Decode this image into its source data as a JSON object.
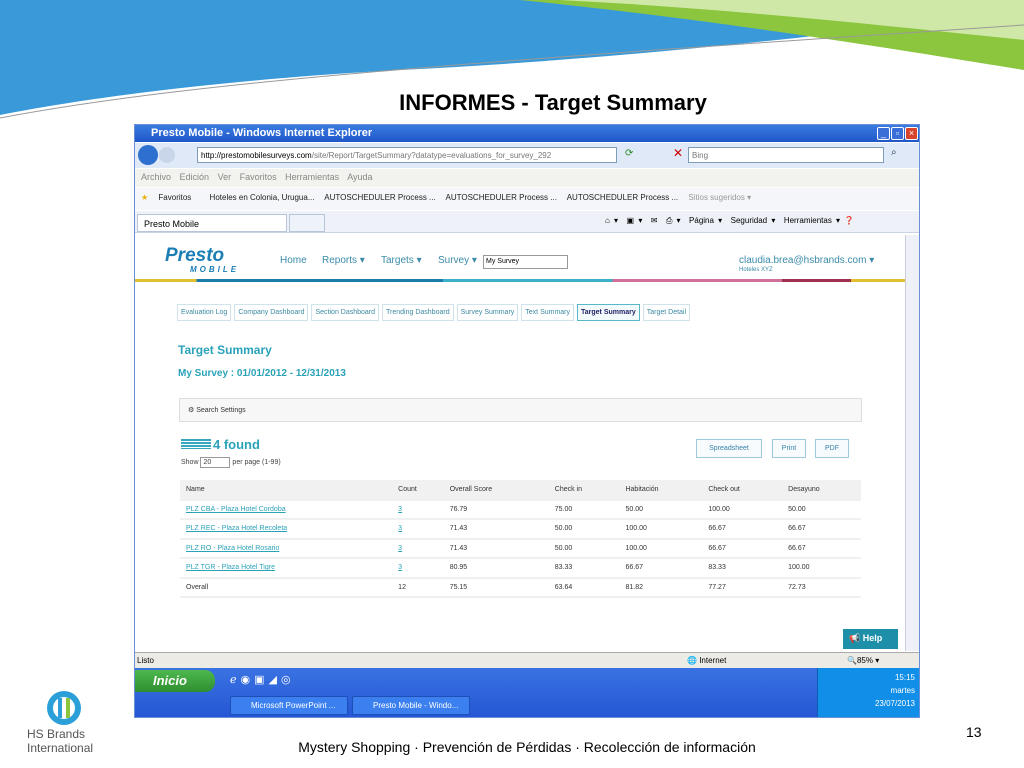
{
  "slide": {
    "title": "INFORMES - Target Summary",
    "footer": "Mystery Shopping · Prevención de Pérdidas · Recolección de información",
    "page_number": "13",
    "logo_line1": "HS Brands",
    "logo_line2": "International"
  },
  "browser": {
    "title": "Presto Mobile - Windows Internet Explorer",
    "url_host": "http://prestomobilesurveys.com",
    "url_path": "/site/Report/TargetSummary?datatype=evaluations_for_survey_292",
    "search_placeholder": "Bing",
    "menu": [
      "Archivo",
      "Edición",
      "Ver",
      "Favoritos",
      "Herramientas",
      "Ayuda"
    ],
    "favorites_label": "Favoritos",
    "favorites": [
      "Hoteles en Colonia, Urugua...",
      "AUTOSCHEDULER  Process ...",
      "AUTOSCHEDULER  Process ...",
      "AUTOSCHEDULER  Process ...",
      "Sitios sugeridos ▾"
    ],
    "tab": "Presto Mobile",
    "commands": [
      "Página ▾",
      "Seguridad ▾",
      "Herramientas ▾"
    ],
    "status": "Listo",
    "zone": "Internet",
    "zoom": "85%"
  },
  "app": {
    "logo_top": "Presto",
    "logo_bottom": "MOBILE",
    "nav": [
      "Home",
      "Reports ▾",
      "Targets ▾",
      "Survey ▾"
    ],
    "survey_value": "My Survey",
    "user_email": "claudia.brea@hsbrands.com",
    "user_company": "Hoteles XYZ",
    "tabs": [
      "Evaluation Log",
      "Company Dashboard",
      "Section Dashboard",
      "Trending Dashboard",
      "Survey Summary",
      "Text Summary",
      "Target Summary",
      "Target Detail"
    ],
    "active_tab": 6,
    "page_title": "Target Summary",
    "subtitle": "My Survey : 01/01/2012 - 12/31/2013",
    "search_settings": "Search Settings",
    "found": "4 found",
    "show_label": "Show",
    "per_page": "20",
    "per_page_suffix": "per page (1-99)",
    "buttons": [
      "Spreadsheet",
      "Print",
      "PDF"
    ],
    "help": "Help",
    "columns": [
      "Name",
      "Count",
      "Overall Score",
      "Check in",
      "Habitación",
      "Check out",
      "Desayuno"
    ],
    "rows": [
      [
        "PLZ CBA - Plaza Hotel Cordoba",
        "3",
        "76.79",
        "75.00",
        "50.00",
        "100.00",
        "50.00"
      ],
      [
        "PLZ REC - Plaza Hotel Recoleta",
        "3",
        "71.43",
        "50.00",
        "100.00",
        "66.67",
        "66.67"
      ],
      [
        "PLZ RO - Plaza Hotel Rosario",
        "3",
        "71.43",
        "50.00",
        "100.00",
        "66.67",
        "66.67"
      ],
      [
        "PLZ TGR - Plaza Hotel Tigre",
        "3",
        "80.95",
        "83.33",
        "66.67",
        "83.33",
        "100.00"
      ],
      [
        "Overall",
        "12",
        "75.15",
        "63.64",
        "81.82",
        "77.27",
        "72.73"
      ]
    ]
  },
  "taskbar": {
    "start": "Inicio",
    "tasks": [
      "Microsoft PowerPoint ...",
      "Presto Mobile - Windo..."
    ],
    "time": "15:15",
    "day": "martes",
    "date": "23/07/2013"
  }
}
